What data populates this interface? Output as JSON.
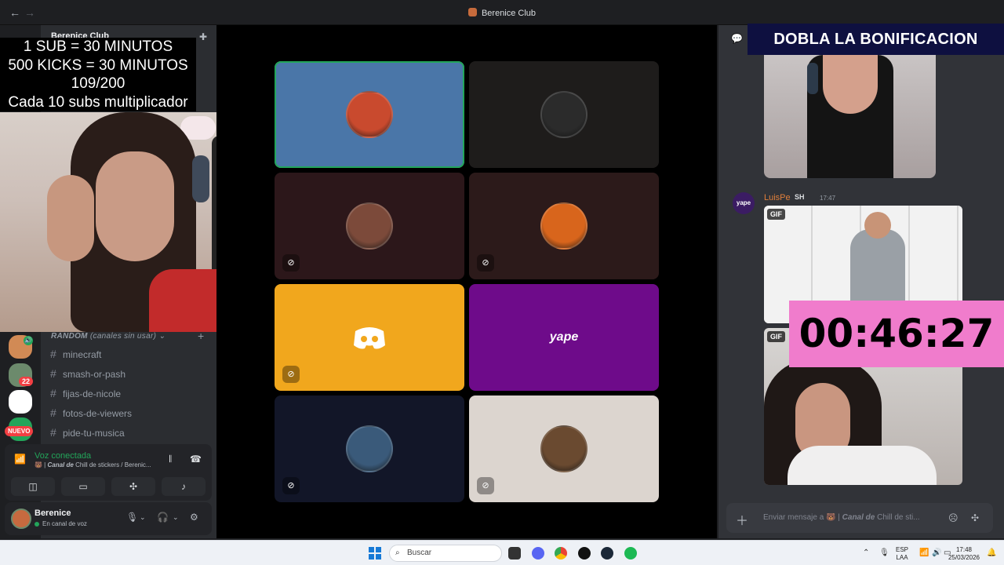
{
  "window": {
    "title": "Berenice Club",
    "back": "←",
    "forward": "→"
  },
  "overlay": {
    "lines": [
      "1 SUB     = 30 MINUTOS",
      "500 KICKS = 30 MINUTOS",
      "109/200",
      "Cada 10 subs multiplicador"
    ]
  },
  "server_header": {
    "name": "Berenice Club"
  },
  "category": {
    "name": "RANDOM",
    "note": "(canales sin usar)",
    "chevron": "⌄",
    "add": "+"
  },
  "channels": [
    "minecraft",
    "smash-or-pash",
    "fijas-de-nicole",
    "fotos-de-viewers",
    "pide-tu-musica"
  ],
  "server_rail": {
    "badge_count": "22",
    "new_badge": "NUEVO"
  },
  "voice": {
    "status": "Voz conectada",
    "channel_prefix": "Canal de",
    "channel_name": "Chill de stickers / Berenic..."
  },
  "user": {
    "name": "Berenice",
    "status": "En canal de voz"
  },
  "stage": {
    "tiles": [
      {
        "bg": "#4a76a8",
        "avatar": "#c94a2e",
        "muted": false,
        "speaking": true
      },
      {
        "bg": "#1e1c1b",
        "avatar": "#2b2b2b",
        "muted": false,
        "speaking": false
      },
      {
        "bg": "#2c171a",
        "avatar": "#7c4a3a",
        "muted": true,
        "speaking": false
      },
      {
        "bg": "#2c1a1a",
        "avatar": "#d8651c",
        "muted": true,
        "speaking": false
      },
      {
        "bg": "#f1a71d",
        "avatar": "discord",
        "muted": true,
        "speaking": false
      },
      {
        "bg": "#6e0b8a",
        "avatar": "yape",
        "muted": false,
        "speaking": false
      },
      {
        "bg": "#121628",
        "avatar": "#3a5a7a",
        "muted": true,
        "speaking": false
      },
      {
        "bg": "#dcd5cf",
        "avatar": "#6a4a30",
        "muted": true,
        "speaking": false
      }
    ]
  },
  "chat": {
    "banner": "DOBLA LA BONIFICACION",
    "message": {
      "author": "LuisPe",
      "tag": "SH",
      "time": "17:47",
      "gif_label": "GIF",
      "avatar_text": "yape"
    },
    "timer": "00:46:27",
    "composer": {
      "placeholder_prefix": "Enviar mensaje a",
      "channel_prefix": "Canal de",
      "channel_name": "Chill de sti..."
    }
  },
  "taskbar": {
    "search": "Buscar",
    "lang_top": "ESP",
    "lang_bottom": "LAA",
    "time": "17:48",
    "date": "25/03/2026"
  },
  "colors": {
    "accent_green": "#23a55a",
    "timer_bg": "#f07ccc",
    "banner_bg": "#0e1040"
  }
}
